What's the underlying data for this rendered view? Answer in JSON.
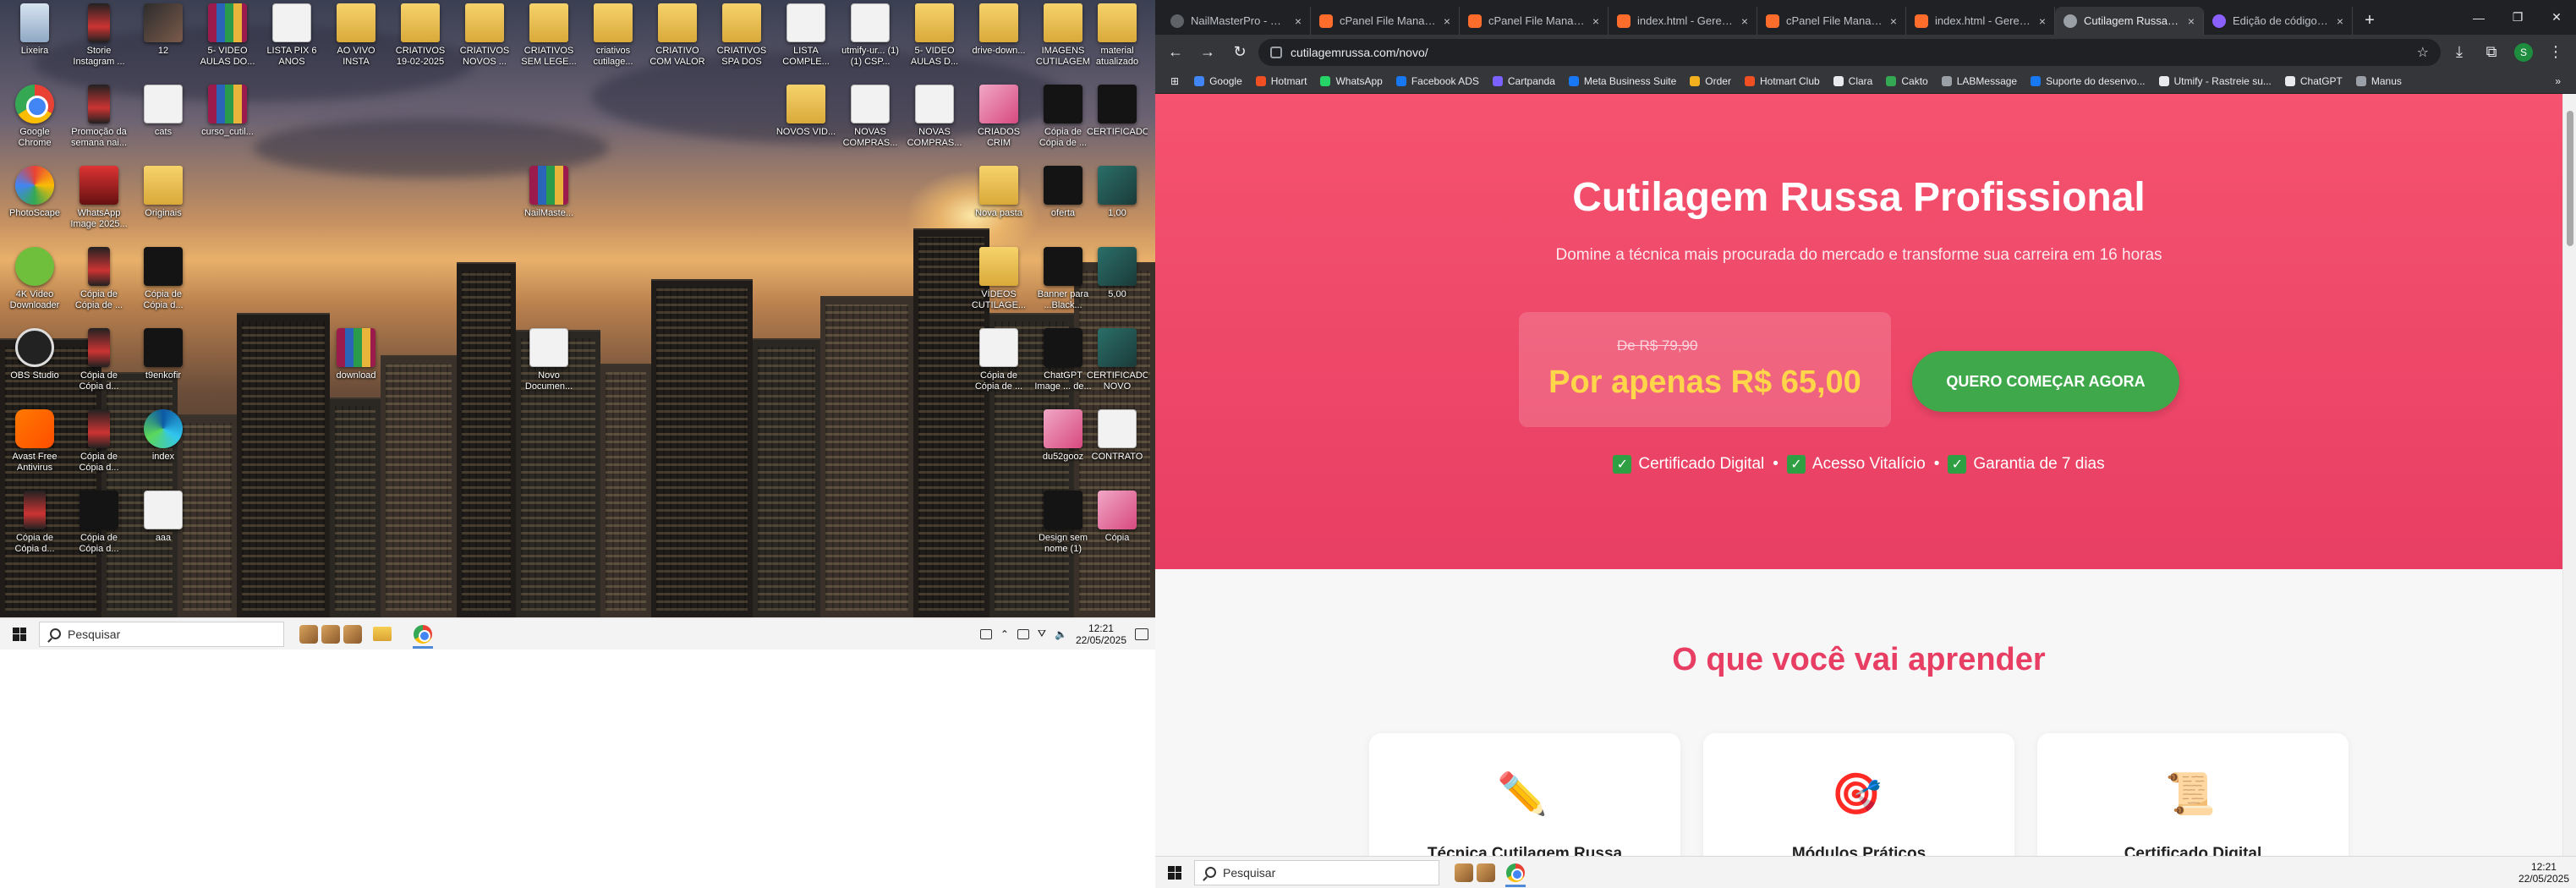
{
  "left_screen": {
    "desktop_icons": [
      {
        "label": "Lixeira",
        "kind": "recycle"
      },
      {
        "label": "Storie Instagram ...",
        "kind": "phone"
      },
      {
        "label": "12",
        "kind": "img"
      },
      {
        "label": "5- VIDEO AULAS DO...",
        "kind": "rar"
      },
      {
        "label": "LISTA PIX 6 ANOS",
        "kind": "doc"
      },
      {
        "label": "AO VIVO INSTA",
        "kind": "folder"
      },
      {
        "label": "CRIATIVOS 19-02-2025",
        "kind": "folder"
      },
      {
        "label": "CRIATIVOS NOVOS ...",
        "kind": "folder"
      },
      {
        "label": "CRIATIVOS SEM LEGE...",
        "kind": "folder"
      },
      {
        "label": "criativos cutilage...",
        "kind": "folder"
      },
      {
        "label": "CRIATIVO COM VALOR",
        "kind": "folder"
      },
      {
        "label": "CRIATIVOS SPA DOS PES",
        "kind": "folder"
      },
      {
        "label": "LISTA COMPLE...",
        "kind": "doc"
      },
      {
        "label": "utmify-ur... (1) (1) CSP...",
        "kind": "doc"
      },
      {
        "label": "5- VIDEO AULAS D...",
        "kind": "folder"
      },
      {
        "label": "drive-down...",
        "kind": "folder"
      },
      {
        "label": "IMAGENS CUTILAGEM",
        "kind": "folder"
      },
      {
        "label": "material atualizado",
        "kind": "folder"
      },
      {
        "label": "Google Chrome",
        "kind": "chrome"
      },
      {
        "label": "Promoção da semana nai...",
        "kind": "phone"
      },
      {
        "label": "cats",
        "kind": "doc"
      },
      {
        "label": "curso_cutil...",
        "kind": "rar"
      },
      {
        "label": "NOVOS VID...",
        "kind": "folder"
      },
      {
        "label": "NOVAS COMPRAS...",
        "kind": "doc"
      },
      {
        "label": "NOVAS COMPRAS...",
        "kind": "doc"
      },
      {
        "label": "CRIADOS CRIM",
        "kind": "pink"
      },
      {
        "label": "Cópia de Cópia de ...",
        "kind": "dark"
      },
      {
        "label": "CERTIFICADO",
        "kind": "dark"
      },
      {
        "label": "PhotoScape",
        "kind": "photo"
      },
      {
        "label": "WhatsApp Image 2025...",
        "kind": "whats"
      },
      {
        "label": "Originais",
        "kind": "folder"
      },
      {
        "label": "NailMaste...",
        "kind": "rar"
      },
      {
        "label": "Nova pasta",
        "kind": "folder"
      },
      {
        "label": "oferta",
        "kind": "dark"
      },
      {
        "label": "1,00",
        "kind": "teal"
      },
      {
        "label": "4K Video Downloader",
        "kind": "android"
      },
      {
        "label": "Cópia de Cópia de ...",
        "kind": "phone"
      },
      {
        "label": "Cópia de Cópia d...",
        "kind": "dark"
      },
      {
        "label": "VÍDEOS CUTILAGE...",
        "kind": "folder"
      },
      {
        "label": "Banner para ...Black...",
        "kind": "dark"
      },
      {
        "label": "5,00",
        "kind": "teal"
      },
      {
        "label": "OBS Studio",
        "kind": "obs"
      },
      {
        "label": "Cópia de Cópia d...",
        "kind": "phone"
      },
      {
        "label": "t9enkofir",
        "kind": "dark"
      },
      {
        "label": "download",
        "kind": "rar"
      },
      {
        "label": "Novo Documen...",
        "kind": "doc"
      },
      {
        "label": "Cópia de Cópia de ...",
        "kind": "doc"
      },
      {
        "label": "ChatGPT Image ... de...",
        "kind": "dark"
      },
      {
        "label": "CERTIFICADO NOVO",
        "kind": "teal"
      },
      {
        "label": "Avast Free Antivirus",
        "kind": "avast"
      },
      {
        "label": "Cópia de Cópia d...",
        "kind": "phone"
      },
      {
        "label": "index",
        "kind": "edge"
      },
      {
        "label": "du52gooz",
        "kind": "pink"
      },
      {
        "label": "CONTRATO",
        "kind": "doc"
      },
      {
        "label": "Cópia de Cópia d...",
        "kind": "phone"
      },
      {
        "label": "Cópia de Cópia d...",
        "kind": "dark"
      },
      {
        "label": "aaa",
        "kind": "doc"
      },
      {
        "label": "Design sem nome (1)",
        "kind": "dark"
      },
      {
        "label": "Cópia",
        "kind": "pink"
      }
    ],
    "taskbar": {
      "search_placeholder": "Pesquisar",
      "time": "12:21",
      "date": "22/05/2025"
    }
  },
  "browser": {
    "tabs": [
      {
        "title": "NailMasterPro - Re...",
        "favicon": "nm"
      },
      {
        "title": "cPanel File Manage...",
        "favicon": "cp"
      },
      {
        "title": "cPanel File Manage...",
        "favicon": "cp"
      },
      {
        "title": "index.html - Gerenc...",
        "favicon": "cp"
      },
      {
        "title": "cPanel File Manage...",
        "favicon": "cp"
      },
      {
        "title": "index.html - Gerenc...",
        "favicon": "cp"
      },
      {
        "title": "Cutilagem Russa - C...",
        "favicon": "cr"
      },
      {
        "title": "Edição de código-f...",
        "favicon": "ed"
      }
    ],
    "new_tab_icon": "+",
    "url": "cutilagemrussa.com/novo/",
    "profile_initial": "S",
    "bookmarks": [
      {
        "label": "Google",
        "color": "#4285f4"
      },
      {
        "label": "Hotmart",
        "color": "#f04e23"
      },
      {
        "label": "WhatsApp",
        "color": "#25d366"
      },
      {
        "label": "Facebook ADS",
        "color": "#1877f2"
      },
      {
        "label": "Cartpanda",
        "color": "#7b61ff"
      },
      {
        "label": "Meta Business Suite",
        "color": "#1877f2"
      },
      {
        "label": "Order",
        "color": "#f2b01e"
      },
      {
        "label": "Hotmart Club",
        "color": "#f04e23"
      },
      {
        "label": "Clara",
        "color": "#e8eaed"
      },
      {
        "label": "Cakto",
        "color": "#34a853"
      },
      {
        "label": "LABMessage",
        "color": "#9aa0a6"
      },
      {
        "label": "Suporte do desenvo...",
        "color": "#1877f2"
      },
      {
        "label": "Utmify - Rastreie su...",
        "color": "#e8eaed"
      },
      {
        "label": "ChatGPT",
        "color": "#e8eaed"
      },
      {
        "label": "Manus",
        "color": "#9aa0a6"
      }
    ],
    "page": {
      "hero_title": "Cutilagem Russa Profissional",
      "hero_subtitle": "Domine a técnica mais procurada do mercado e transforme sua carreira em 16 horas",
      "old_price": "De R$ 79,90",
      "new_price": "Por apenas R$ 65,00",
      "cta_label": "QUERO COMEÇAR AGORA",
      "features": [
        "Certificado Digital",
        "Acesso Vitalício",
        "Garantia de 7 dias"
      ],
      "section_title": "O que você vai aprender",
      "cards": [
        {
          "title": "Técnica Cutilagem Russa",
          "icon": "pencil-icon"
        },
        {
          "title": "Módulos Práticos",
          "icon": "target-icon"
        },
        {
          "title": "Certificado Digital",
          "icon": "scroll-icon"
        }
      ],
      "colors": {
        "hero": "#e83e63",
        "cta": "#3ea84a",
        "price": "#ffd54a"
      }
    },
    "taskbar": {
      "search_placeholder": "Pesquisar",
      "time": "12:21",
      "date": "22/05/2025"
    }
  }
}
